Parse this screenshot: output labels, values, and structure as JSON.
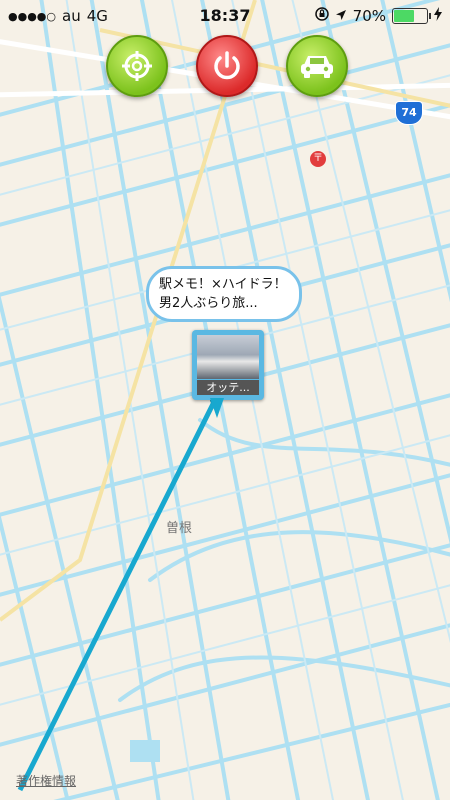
{
  "status_bar": {
    "signal_dots": "●●●●○",
    "carrier": "au",
    "network": "4G",
    "time": "18:37",
    "battery_percent": "70%",
    "battery_level": 0.7,
    "icons": [
      "orientation-lock-icon",
      "location-arrow-icon",
      "battery-icon",
      "charging-bolt-icon"
    ]
  },
  "toolbar": {
    "buttons": [
      {
        "name": "crosshair-icon",
        "color": "#7cc21c"
      },
      {
        "name": "power-icon",
        "color": "#dc2a2a"
      },
      {
        "name": "car-icon",
        "color": "#7cc21c"
      }
    ]
  },
  "map": {
    "area_label": "曽根",
    "route_number": "74",
    "copyright_link": "著作権情報",
    "road_color": "#aee0f2",
    "route_line_color": "#18a8cf"
  },
  "callout": {
    "line1": "駅メモ！×ハイドラ！",
    "line2": "男2人ぶらり旅..."
  },
  "pin": {
    "label": "オッテ..."
  }
}
